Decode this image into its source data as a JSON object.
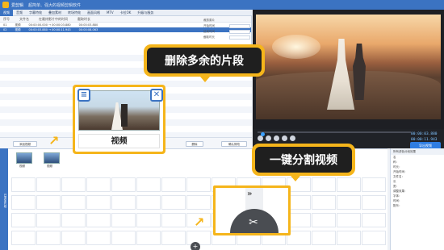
{
  "app": {
    "title": "爱剪辑",
    "subtitle": "超简单、强大的视频剪辑软件"
  },
  "tabs": [
    "视频",
    "音频",
    "字幕特效",
    "叠加素材",
    "转场特效",
    "画面风格",
    "MTV",
    "卡拉OK",
    "升级与服务"
  ],
  "list": {
    "headers": [
      "序号",
      "文件名",
      "在最终影片中的时间",
      "截取时长"
    ],
    "rows": [
      {
        "no": "01",
        "name": "视频",
        "time": "00:00:00.000 → 00:00:03.880",
        "dur": "00:00:03.880",
        "selected": false
      },
      {
        "no": "02",
        "name": "视频",
        "time": "00:00:03.880 → 00:00:11.943",
        "dur": "00:00:08.063",
        "selected": true
      }
    ]
  },
  "info": {
    "title": "裁剪原片",
    "labels": [
      "开始时间",
      "结束时间",
      "截取时长",
      "开始时间",
      "结束时间"
    ]
  },
  "buttons": {
    "add_video": "添加视频",
    "delete": "删除",
    "confirm_edit": "确认修改"
  },
  "player": {
    "time_current": "00:00:03.880",
    "time_total": "00:00:11.943"
  },
  "timeline": {
    "side_tab": "已添加片段",
    "clips": [
      "视频",
      "视频"
    ]
  },
  "right_panel": {
    "header": "所有滤色分段效果",
    "props": [
      "名",
      "称：",
      "时长：",
      "开始时间：",
      "文件名：",
      "长",
      "宽：",
      "调整效果：",
      "字体：",
      "时间：",
      "配乐："
    ]
  },
  "export": "导出视频",
  "callouts": {
    "delete_segments": "删除多余的片段",
    "split_video": "一键分割视频"
  },
  "popup": {
    "label": "视频"
  },
  "icons": {
    "list_icon": "list-icon",
    "close_icon": "close-icon",
    "scissor_icon": "scissor-icon",
    "chevron_icon": "chevron-right-icon",
    "add_icon": "plus-icon"
  }
}
